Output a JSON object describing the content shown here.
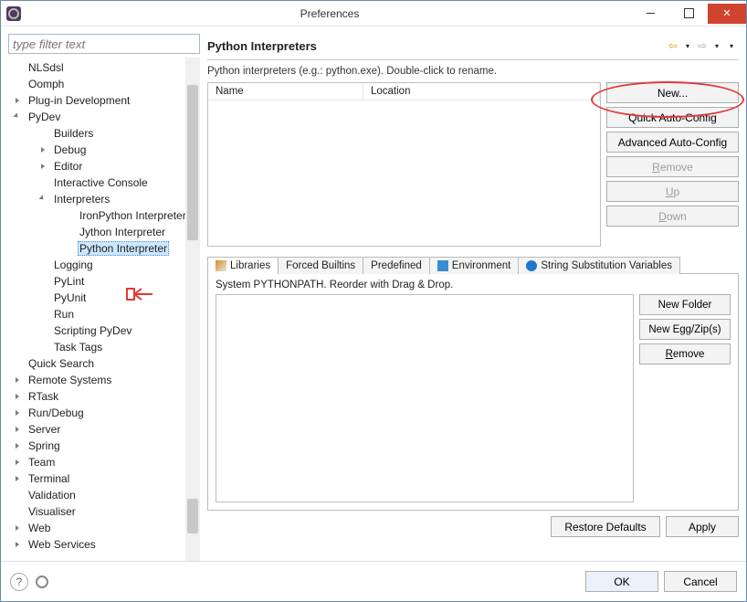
{
  "window": {
    "title": "Preferences"
  },
  "filter": {
    "placeholder": "type filter text"
  },
  "tree": [
    {
      "label": "NLSdsl",
      "leaf": true,
      "expand": "closed"
    },
    {
      "label": "Oomph",
      "leaf": true
    },
    {
      "label": "Plug-in Development",
      "expand": "closed"
    },
    {
      "label": "PyDev",
      "expand": "open",
      "children": [
        {
          "label": "Builders",
          "leaf": true
        },
        {
          "label": "Debug",
          "expand": "closed"
        },
        {
          "label": "Editor",
          "expand": "closed"
        },
        {
          "label": "Interactive Console",
          "leaf": true
        },
        {
          "label": "Interpreters",
          "expand": "open",
          "children": [
            {
              "label": "IronPython Interpreter",
              "leaf": true
            },
            {
              "label": "Jython Interpreter",
              "leaf": true
            },
            {
              "label": "Python Interpreter",
              "leaf": true,
              "selected": true
            }
          ]
        },
        {
          "label": "Logging",
          "leaf": true
        },
        {
          "label": "PyLint",
          "leaf": true
        },
        {
          "label": "PyUnit",
          "leaf": true
        },
        {
          "label": "Run",
          "leaf": true
        },
        {
          "label": "Scripting PyDev",
          "leaf": true
        },
        {
          "label": "Task Tags",
          "leaf": true
        }
      ]
    },
    {
      "label": "Quick Search",
      "leaf": true
    },
    {
      "label": "Remote Systems",
      "expand": "closed"
    },
    {
      "label": "RTask",
      "expand": "closed"
    },
    {
      "label": "Run/Debug",
      "expand": "closed"
    },
    {
      "label": "Server",
      "expand": "closed"
    },
    {
      "label": "Spring",
      "expand": "closed"
    },
    {
      "label": "Team",
      "expand": "closed"
    },
    {
      "label": "Terminal",
      "expand": "closed"
    },
    {
      "label": "Validation",
      "leaf": true
    },
    {
      "label": "Visualiser",
      "leaf": true
    },
    {
      "label": "Web",
      "expand": "closed"
    },
    {
      "label": "Web Services",
      "expand": "closed"
    }
  ],
  "page": {
    "title": "Python Interpreters",
    "hint": "Python interpreters (e.g.: python.exe).   Double-click to rename.",
    "table": {
      "columns": [
        "Name",
        "Location"
      ]
    },
    "side_buttons": [
      {
        "label": "New...",
        "enabled": true
      },
      {
        "label": "Quick Auto-Config",
        "enabled": true
      },
      {
        "label": "Advanced Auto-Config",
        "enabled": true
      },
      {
        "label": "Remove",
        "enabled": false,
        "key": "R"
      },
      {
        "label": "Up",
        "enabled": false,
        "key": "U"
      },
      {
        "label": "Down",
        "enabled": false,
        "key": "D"
      }
    ],
    "tabs": [
      {
        "label": "Libraries",
        "icon": "lib",
        "active": true
      },
      {
        "label": "Forced Builtins"
      },
      {
        "label": "Predefined"
      },
      {
        "label": "Environment",
        "icon": "env"
      },
      {
        "label": "String Substitution Variables",
        "icon": "dot"
      }
    ],
    "pythonpath": {
      "hint": "System PYTHONPATH.   Reorder with Drag & Drop.",
      "buttons": [
        "New Folder",
        "New Egg/Zip(s)",
        "Remove"
      ]
    },
    "restore_defaults": "Restore Defaults",
    "apply": "Apply"
  },
  "footer": {
    "ok": "OK",
    "cancel": "Cancel"
  }
}
